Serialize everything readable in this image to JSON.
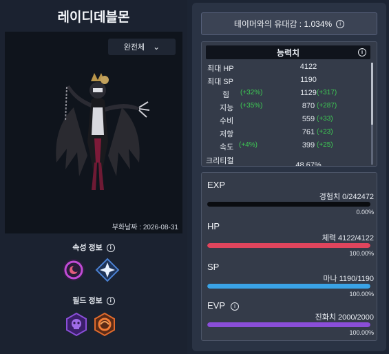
{
  "creature": {
    "name": "레이디데블몬",
    "form_label": "완전체",
    "hatch_date": "부화날짜 : 2026-08-31",
    "attribute_info_label": "속성 정보",
    "field_info_label": "필드 정보"
  },
  "affinity": {
    "label": "테이머와의 유대감 : 1.034%"
  },
  "stats": {
    "title": "능력치",
    "rows": [
      {
        "label": "최대 HP",
        "pct": "",
        "value": "4122",
        "bonus": ""
      },
      {
        "label": "최대 SP",
        "pct": "",
        "value": "1190",
        "bonus": ""
      },
      {
        "label": "힘",
        "pct": "(+32%)",
        "value": "1129",
        "bonus": "(+317)"
      },
      {
        "label": "지능",
        "pct": "(+35%)",
        "value": "870",
        "bonus": "(+287)"
      },
      {
        "label": "수비",
        "pct": "",
        "value": "559",
        "bonus": "(+33)"
      },
      {
        "label": "저항",
        "pct": "",
        "value": "761",
        "bonus": "(+23)"
      },
      {
        "label": "속도",
        "pct": "(+4%)",
        "value": "399",
        "bonus": "(+25)"
      },
      {
        "label": "크리티컬",
        "pct": "",
        "value": "48.67%",
        "bonus": ""
      }
    ]
  },
  "bars": [
    {
      "title": "EXP",
      "detail": "경험치 0/242472",
      "percent": "0.00%",
      "fill": 0.0,
      "color": "#2f3a4a",
      "info": false
    },
    {
      "title": "HP",
      "detail": "체력 4122/4122",
      "percent": "100.00%",
      "fill": 1.0,
      "color": "#e0455d",
      "info": false
    },
    {
      "title": "SP",
      "detail": "마나 1190/1190",
      "percent": "100.00%",
      "fill": 1.0,
      "color": "#3aa3e6",
      "info": false
    },
    {
      "title": "EVP",
      "detail": "진화치 2000/2000",
      "percent": "100.00%",
      "fill": 1.0,
      "color": "#8a4ed8",
      "info": true
    }
  ],
  "colors": {
    "panel": "#343b49",
    "accent_green": "#3ecb54"
  },
  "icons": [
    "info-icon",
    "chevron-down-icon",
    "virus-attribute-icon",
    "light-element-icon",
    "dark-area-field-icon",
    "metal-empire-field-icon"
  ]
}
